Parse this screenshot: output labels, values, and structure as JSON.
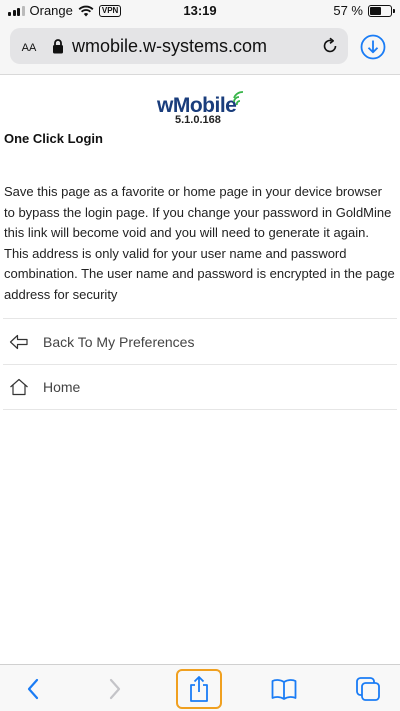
{
  "status_bar": {
    "carrier": "Orange",
    "vpn": "VPN",
    "time": "13:19",
    "battery": "57 %",
    "battery_level": 0.57
  },
  "browser": {
    "text_size_label": "AA",
    "url": "wmobile.w-systems.com",
    "icons": [
      "lock-icon",
      "reload-icon",
      "download-icon"
    ]
  },
  "page": {
    "logo_text": "wMobile",
    "version": "5.1.0.168",
    "title": "One Click Login",
    "description": "Save this page as a favorite or home page in your device browser to bypass the login page. If you change your password in GoldMine this link will become void and you will need to generate it again. This address is only valid for your user name and password combination. The user name and password is encrypted in the page address for security",
    "nav_items": [
      {
        "label": "Back To My Preferences",
        "icon": "back-arrow-icon"
      },
      {
        "label": "Home",
        "icon": "home-icon"
      }
    ]
  },
  "toolbar": {
    "items": [
      "back-icon",
      "forward-icon",
      "share-icon",
      "bookmarks-icon",
      "tabs-icon"
    ],
    "accent_color": "#1a7cf5",
    "highlight_color": "#f0a020"
  }
}
